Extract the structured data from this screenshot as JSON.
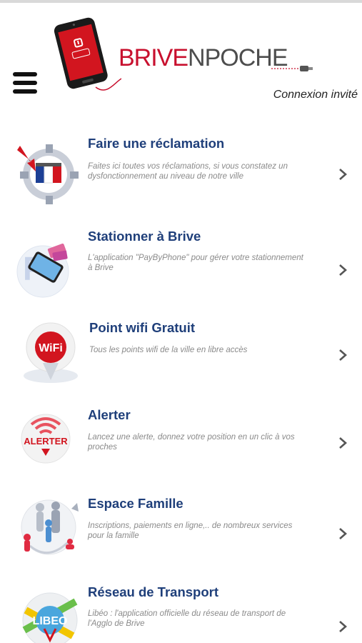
{
  "app": {
    "logo_brand_a": "BRIVE",
    "logo_brand_b": "NPOCHE",
    "login_label": "Connexion invité"
  },
  "colors": {
    "title_blue": "#1f3f7a",
    "brand_red": "#c8102e",
    "description_gray": "#8a8a8a"
  },
  "menu": {
    "icon": "hamburger-menu-icon"
  },
  "items": [
    {
      "title": "Faire une réclamation",
      "description": "Faites ici toutes vos réclamations, si vous constatez un dysfonctionnement au niveau de notre ville",
      "icon": "complaint-gear-icon"
    },
    {
      "title": "Stationner à Brive",
      "description": "L'application \"PayByPhone\" pour gérer votre stationnement à Brive",
      "icon": "parking-phone-icon"
    },
    {
      "title": "Point wifi Gratuit",
      "description": "Tous les points wifi de la ville en libre accès",
      "icon": "wifi-pin-icon"
    },
    {
      "title": "Alerter",
      "description": "Lancez une alerte, donnez votre position en un clic à vos proches",
      "icon": "alert-signal-icon"
    },
    {
      "title": "Espace Famille",
      "description": "Inscriptions, paiements en ligne,.. de nombreux services pour la famille",
      "icon": "family-icon"
    },
    {
      "title": "Réseau de Transport",
      "description": "Libéo : l'application officielle du réseau de transport de l'Agglo de Brive",
      "icon": "libeo-transport-icon"
    }
  ]
}
